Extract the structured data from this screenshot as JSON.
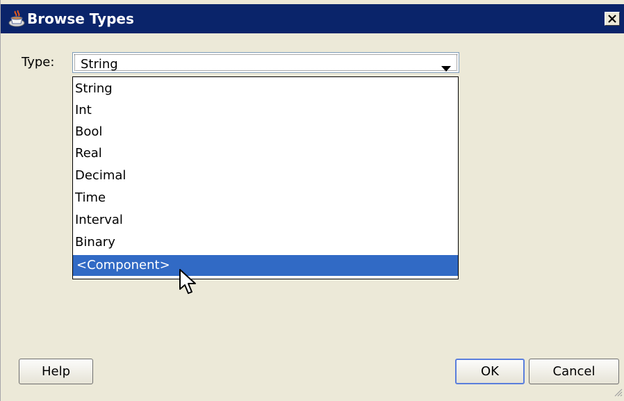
{
  "window": {
    "title": "Browse Types",
    "title_bar_color": "#0a246a",
    "icon": "coffee-cup-icon",
    "close_icon": "close-icon"
  },
  "type_field": {
    "label": "Type:",
    "selected_value": "String",
    "arrow_icon": "chevron-down-icon"
  },
  "dropdown": {
    "highlight_color": "#316ac5",
    "items": [
      {
        "label": "String",
        "highlighted": false
      },
      {
        "label": "Int",
        "highlighted": false
      },
      {
        "label": "Bool",
        "highlighted": false
      },
      {
        "label": "Real",
        "highlighted": false
      },
      {
        "label": "Decimal",
        "highlighted": false
      },
      {
        "label": "Time",
        "highlighted": false
      },
      {
        "label": "Interval",
        "highlighted": false
      },
      {
        "label": "Binary",
        "highlighted": false
      },
      {
        "label": "<Component>",
        "highlighted": true
      }
    ]
  },
  "buttons": {
    "help": "Help",
    "ok": "OK",
    "cancel": "Cancel"
  }
}
